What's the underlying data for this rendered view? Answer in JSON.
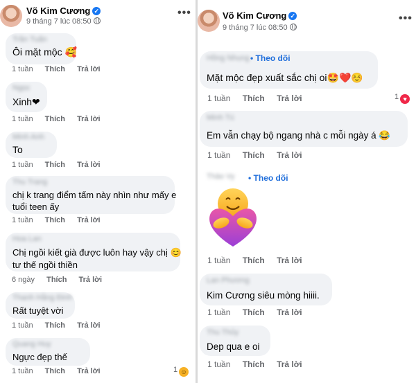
{
  "left": {
    "author": "Võ Kim Cương",
    "date": "9 tháng 7 lúc 08:50",
    "more": "•••",
    "comments": [
      {
        "text": "Ôi mặt mộc 🥰",
        "time": "1 tuần",
        "like": "Thích",
        "reply": "Trả lời"
      },
      {
        "text": "Xinh❤",
        "time": "1 tuần",
        "like": "Thích",
        "reply": "Trả lời"
      },
      {
        "text": "To",
        "time": "1 tuần",
        "like": "Thích",
        "reply": "Trả lời"
      },
      {
        "line1": "chị k trang điểm tấm này nhìn như mấy e",
        "line2": "tuổi teen ấy",
        "time": "1 tuần",
        "like": "Thích",
        "reply": "Trả lời"
      },
      {
        "line1": "Chị ngồi kiết già được luôn hay vậy chị 😊",
        "line2": "tư thế ngồi thiền",
        "time": "6 ngày",
        "like": "Thích",
        "reply": "Trả lời"
      },
      {
        "text": "Rất tuyệt vời",
        "time": "1 tuần",
        "like": "Thích",
        "reply": "Trả lời"
      },
      {
        "text": "Ngực đẹp thế",
        "time": "1 tuần",
        "like": "Thích",
        "reply": "Trả lời",
        "reactions": "1"
      }
    ]
  },
  "right": {
    "author": "Võ Kim Cương",
    "date": "9 tháng 7 lúc 08:50",
    "more": "•••",
    "comments": [
      {
        "follow": "• Theo dõi",
        "text": "Mặt mộc đẹp xuất sắc chị oi🤩❤️☺️",
        "time": "1 tuần",
        "like": "Thích",
        "reply": "Trả lời",
        "reactions": "1"
      },
      {
        "text": "Em vẫn chạy bộ ngang nhà c mỗi ngày á 😂",
        "time": "1 tuần",
        "like": "Thích",
        "reply": "Trả lời"
      },
      {
        "follow": "• Theo dõi",
        "sticker": "hug-emoji",
        "time": "1 tuần",
        "like": "Thích",
        "reply": "Trả lời"
      },
      {
        "text": "Kim Cương siêu mòng hiiii.",
        "time": "1 tuần",
        "like": "Thích",
        "reply": "Trả lời"
      },
      {
        "text": "Dep qua e oi",
        "time": "1 tuần",
        "like": "Thích",
        "reply": "Trả lời"
      }
    ]
  },
  "colors": {
    "link": "#216fdb",
    "bubble": "#f0f2f5",
    "meta": "#65676b",
    "verified": "#1877f2"
  }
}
